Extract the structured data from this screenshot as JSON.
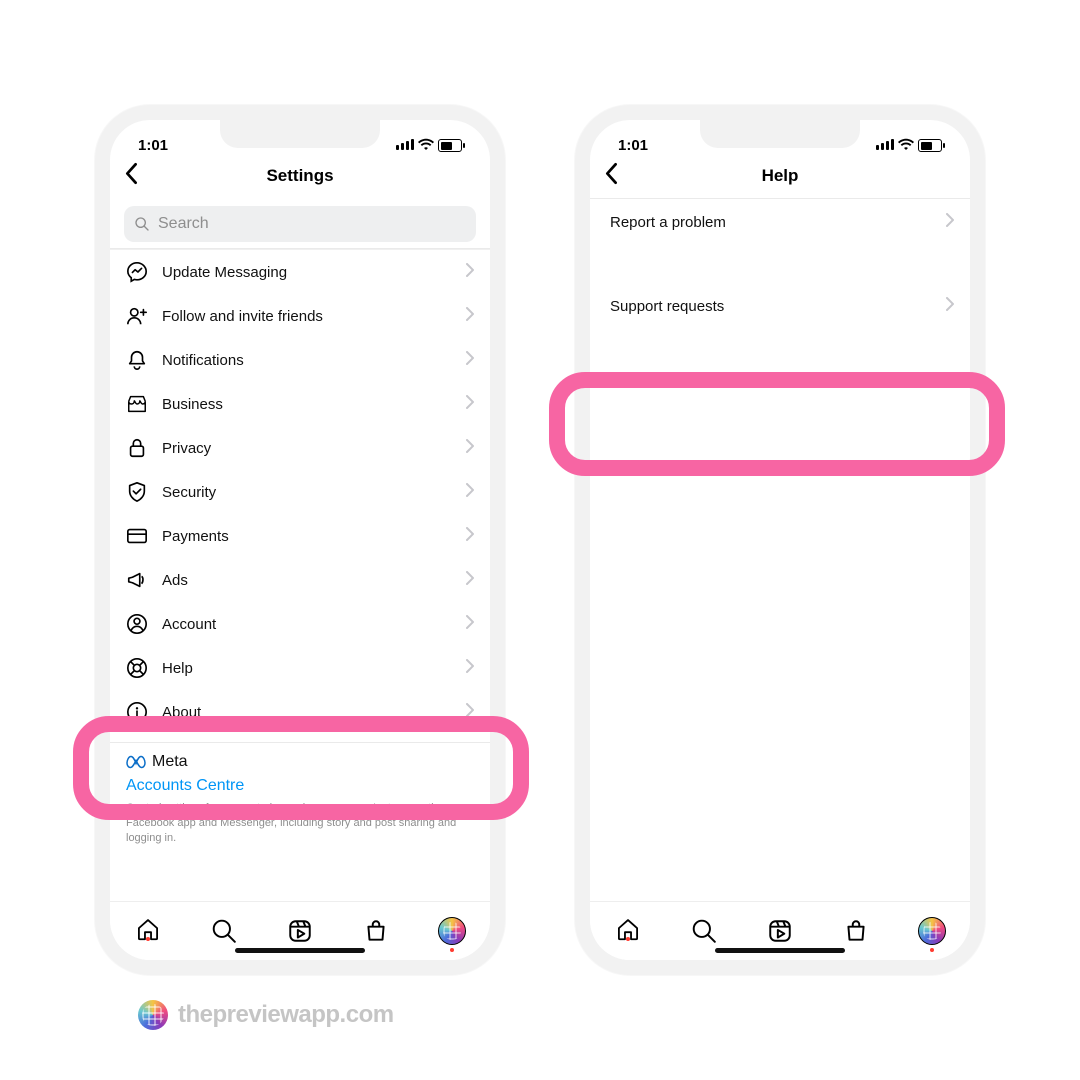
{
  "status": {
    "time": "1:01"
  },
  "settings": {
    "title": "Settings",
    "search_placeholder": "Search",
    "items": [
      {
        "icon": "messenger",
        "label": "Update Messaging"
      },
      {
        "icon": "addfriend",
        "label": "Follow and invite friends"
      },
      {
        "icon": "bell",
        "label": "Notifications"
      },
      {
        "icon": "store",
        "label": "Business"
      },
      {
        "icon": "lock",
        "label": "Privacy"
      },
      {
        "icon": "shield",
        "label": "Security"
      },
      {
        "icon": "card",
        "label": "Payments"
      },
      {
        "icon": "megaphone",
        "label": "Ads"
      },
      {
        "icon": "person",
        "label": "Account"
      },
      {
        "icon": "lifebuoy",
        "label": "Help"
      },
      {
        "icon": "info",
        "label": "About"
      }
    ],
    "meta_brand": "Meta",
    "accounts_centre": "Accounts Centre",
    "meta_desc": "Control settings for connected experiences across Instagram, the Facebook app and Messenger, including story and post sharing and logging in."
  },
  "help": {
    "title": "Help",
    "items": [
      {
        "label": "Report a problem"
      },
      {
        "label": "Support requests"
      }
    ]
  },
  "watermark": "thepreviewapp.com"
}
